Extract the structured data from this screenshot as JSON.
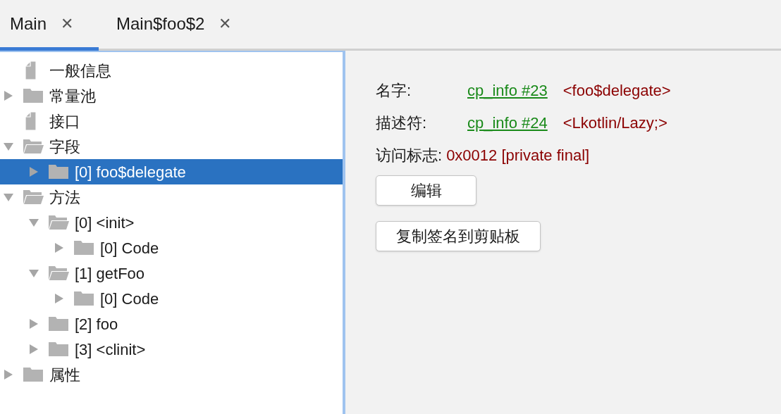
{
  "tabs": [
    {
      "label": "Main",
      "close": "✕",
      "selected": true
    },
    {
      "label": "Main$foo$2",
      "close": "✕",
      "selected": false
    }
  ],
  "tree": [
    {
      "label": "一般信息",
      "kind": "file",
      "selected": false
    },
    {
      "label": "常量池",
      "kind": "folder",
      "expanded": false,
      "selected": false
    },
    {
      "label": "接口",
      "kind": "file",
      "selected": false
    },
    {
      "label": "字段",
      "kind": "folder",
      "expanded": true,
      "selected": false,
      "children": [
        {
          "label": "[0] foo$delegate",
          "kind": "folder",
          "expanded": false,
          "selected": true
        }
      ]
    },
    {
      "label": "方法",
      "kind": "folder",
      "expanded": true,
      "selected": false,
      "children": [
        {
          "label": "[0] <init>",
          "kind": "folder",
          "expanded": true,
          "selected": false,
          "children": [
            {
              "label": "[0] Code",
              "kind": "folder",
              "expanded": false,
              "selected": false
            }
          ]
        },
        {
          "label": "[1] getFoo",
          "kind": "folder",
          "expanded": true,
          "selected": false,
          "children": [
            {
              "label": "[0] Code",
              "kind": "folder",
              "expanded": false,
              "selected": false
            }
          ]
        },
        {
          "label": "[2] foo",
          "kind": "folder",
          "expanded": false,
          "selected": false
        },
        {
          "label": "[3] <clinit>",
          "kind": "folder",
          "expanded": false,
          "selected": false
        }
      ]
    },
    {
      "label": "属性",
      "kind": "folder",
      "expanded": false,
      "selected": false
    }
  ],
  "details": {
    "fields": [
      {
        "label": "名字:",
        "link": "cp_info #23",
        "value": "<foo$delegate>"
      },
      {
        "label": "描述符:",
        "link": "cp_info #24",
        "value": "<Lkotlin/Lazy;>"
      }
    ],
    "access": {
      "label": "访问标志:",
      "value": "0x0012 [private final]"
    },
    "buttons": [
      "编辑",
      "复制签名到剪贴板"
    ]
  }
}
